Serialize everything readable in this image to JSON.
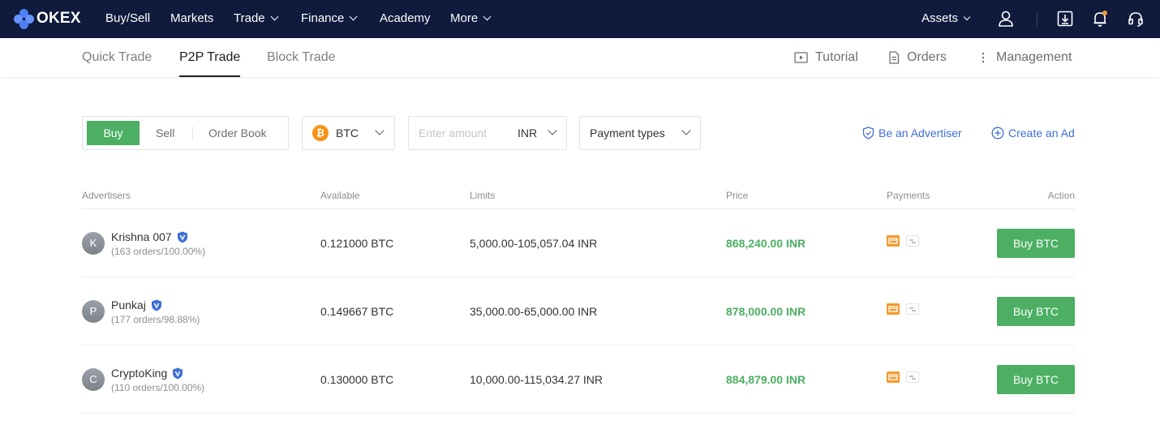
{
  "brand": {
    "name": "OKEX"
  },
  "topnav": {
    "items": [
      {
        "label": "Buy/Sell",
        "has_dropdown": false
      },
      {
        "label": "Markets",
        "has_dropdown": false
      },
      {
        "label": "Trade",
        "has_dropdown": true
      },
      {
        "label": "Finance",
        "has_dropdown": true
      },
      {
        "label": "Academy",
        "has_dropdown": false
      },
      {
        "label": "More",
        "has_dropdown": true
      }
    ],
    "assets_label": "Assets",
    "icons": [
      "user-icon",
      "download-icon",
      "bell-icon",
      "headset-icon"
    ]
  },
  "subnav": {
    "tabs": [
      {
        "label": "Quick Trade",
        "active": false
      },
      {
        "label": "P2P Trade",
        "active": true
      },
      {
        "label": "Block Trade",
        "active": false
      }
    ],
    "links": [
      {
        "label": "Tutorial",
        "icon": "play-icon"
      },
      {
        "label": "Orders",
        "icon": "document-icon"
      },
      {
        "label": "Management",
        "icon": "more-vertical-icon"
      }
    ]
  },
  "filters": {
    "side_tabs": {
      "buy": "Buy",
      "sell": "Sell",
      "order_book": "Order Book",
      "selected": "Buy"
    },
    "coin": {
      "symbol": "BTC",
      "icon_glyph": "₿"
    },
    "amount": {
      "placeholder": "Enter amount",
      "value": "",
      "currency": "INR"
    },
    "payment": {
      "label": "Payment types"
    },
    "be_advertiser": "Be an Advertiser",
    "create_ad": "Create an Ad"
  },
  "table": {
    "headers": {
      "advertisers": "Advertisers",
      "available": "Available",
      "limits": "Limits",
      "price": "Price",
      "payments": "Payments",
      "action": "Action"
    },
    "rows": [
      {
        "initial": "K",
        "name": "Krishna 007",
        "stats": "(163 orders/100.00%)",
        "available": "0.121000 BTC",
        "limits": "5,000.00-105,057.04 INR",
        "price": "868,240.00 INR",
        "action": "Buy BTC"
      },
      {
        "initial": "P",
        "name": "Punkaj",
        "stats": "(177 orders/98.88%)",
        "available": "0.149667 BTC",
        "limits": "35,000.00-65,000.00 INR",
        "price": "878,000.00 INR",
        "action": "Buy BTC"
      },
      {
        "initial": "C",
        "name": "CryptoKing",
        "stats": "(110 orders/100.00%)",
        "available": "0.130000 BTC",
        "limits": "10,000.00-115,034.27 INR",
        "price": "884,879.00 INR",
        "action": "Buy BTC"
      }
    ]
  },
  "colors": {
    "nav_bg": "#0f1a3c",
    "accent_green": "#4caf63",
    "link_blue": "#3f6fd8",
    "bank_orange": "#f59a2f"
  }
}
